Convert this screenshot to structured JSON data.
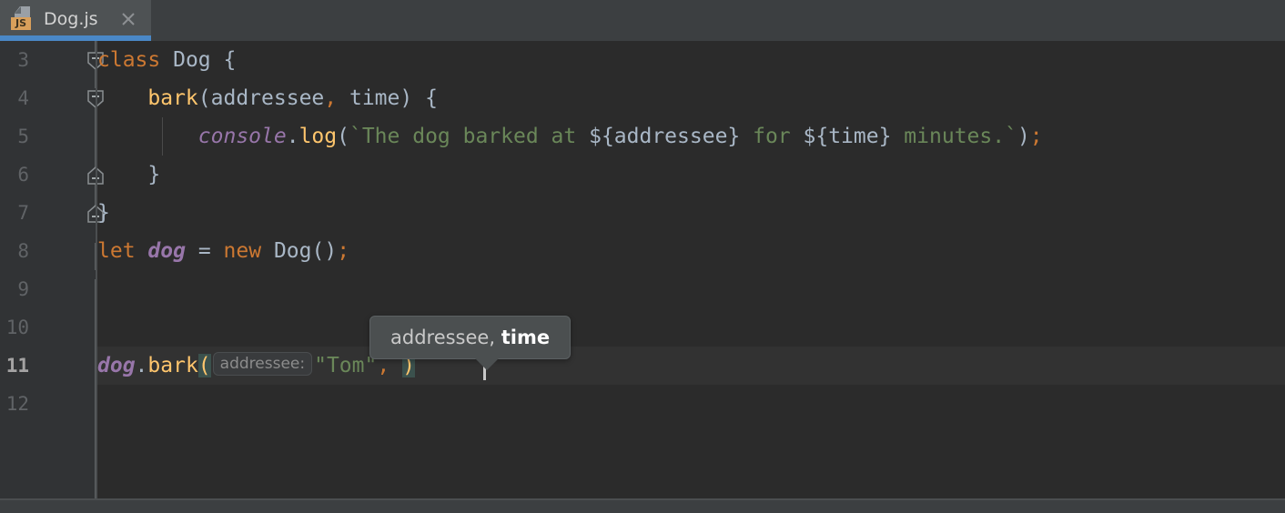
{
  "window": {
    "theme": "darcula",
    "accent_blue": "#4a88c7",
    "background": "#2b2b2b",
    "gutter_background": "#313335"
  },
  "tabbar": {
    "active_tab": {
      "title": "Dog.js",
      "icon": "javascript-file-icon",
      "badge": "JS",
      "close_icon": "close-icon",
      "selected": true
    }
  },
  "editor": {
    "first_visible_line": 3,
    "current_line": 11,
    "line_numbers": [
      "3",
      "4",
      "5",
      "6",
      "7",
      "8",
      "9",
      "10",
      "11",
      "12"
    ],
    "lines": [
      {
        "number": "3",
        "text": "class Dog {"
      },
      {
        "number": "4",
        "text": "    bark(addressee, time) {"
      },
      {
        "number": "5",
        "text": "        console.log(`The dog barked at ${addressee} for ${time} minutes.`);"
      },
      {
        "number": "6",
        "text": "    }"
      },
      {
        "number": "7",
        "text": "}"
      },
      {
        "number": "8",
        "text": "let dog = new Dog();"
      },
      {
        "number": "9",
        "text": ""
      },
      {
        "number": "10",
        "text": ""
      },
      {
        "number": "11",
        "text": "dog.bark( addressee: \"Tom\", )"
      },
      {
        "number": "12",
        "text": ""
      }
    ],
    "tokens": {
      "l3": {
        "kw": "class",
        "sp1": " ",
        "name": "Dog",
        "sp2": " ",
        "brace": "{"
      },
      "l4": {
        "indent": "    ",
        "fn": "bark",
        "open": "(",
        "params": "addressee",
        "comma": ",",
        "sp": " ",
        "param2": "time",
        "close": ")",
        "sp2": " ",
        "brace": "{"
      },
      "l5": {
        "indent": "        ",
        "obj": "console",
        "dot": ".",
        "fn": "log",
        "open": "(",
        "str1": "`The dog barked at ",
        "tmpl1": "${addressee}",
        "str2": " for ",
        "tmpl2": "${time}",
        "str3": " minutes.`",
        "close": ")",
        "semi": ";"
      },
      "l6": {
        "indent": "    ",
        "brace": "}"
      },
      "l7": {
        "brace": "}"
      },
      "l8": {
        "kw1": "let",
        "sp1": " ",
        "var": "dog",
        "sp2": " ",
        "eq": "=",
        "sp3": " ",
        "kw2": "new",
        "sp4": " ",
        "ctor": "Dog()",
        "semi": ";"
      },
      "l11": {
        "obj": "dog",
        "dot": ".",
        "fn": "bark",
        "open": "(",
        "hint": "addressee:",
        "str": "\"Tom\"",
        "comma": ",",
        "close": ")"
      }
    },
    "colors": {
      "keyword": "#cc7832",
      "function": "#ffc66d",
      "identifier": "#a9b7c6",
      "field": "#9876aa",
      "string": "#6a8759",
      "line_number": "#606366",
      "current_line_number": "#a4a3a3",
      "brace_match_background": "#3b514d",
      "caret": "#c8c8c8"
    },
    "fold_markers": [
      {
        "line": "3",
        "state": "expanded-start"
      },
      {
        "line": "4",
        "state": "expanded-start"
      },
      {
        "line": "6",
        "state": "expanded-end"
      },
      {
        "line": "7",
        "state": "expanded-end"
      }
    ]
  },
  "tooltip": {
    "signature_normal": "addressee,",
    "signature_space": " ",
    "signature_bold": "time",
    "kind": "parameter-info"
  }
}
